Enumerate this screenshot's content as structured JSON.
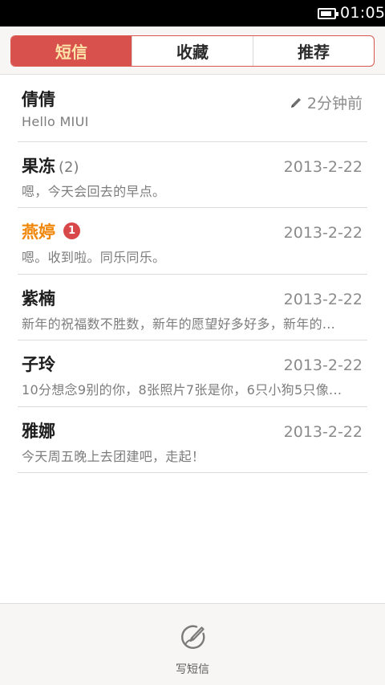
{
  "status_bar": {
    "time": "01:05",
    "battery_level": 0.85
  },
  "tabs": [
    {
      "label": "短信",
      "active": true
    },
    {
      "label": "收藏",
      "active": false
    },
    {
      "label": "推荐",
      "active": false
    }
  ],
  "conversations": [
    {
      "name": "倩倩",
      "count": "",
      "badge": "",
      "time": "2分钟前",
      "draft": true,
      "snippet": "Hello MIUI",
      "unread": false
    },
    {
      "name": "果冻",
      "count": "(2)",
      "badge": "",
      "time": "2013-2-22",
      "draft": false,
      "snippet": "嗯，今天会回去的早点。",
      "unread": false
    },
    {
      "name": "燕婷",
      "count": "",
      "badge": "1",
      "time": "2013-2-22",
      "draft": false,
      "snippet": "嗯。收到啦。同乐同乐。",
      "unread": true
    },
    {
      "name": "紫楠",
      "count": "",
      "badge": "",
      "time": "2013-2-22",
      "draft": false,
      "snippet": "新年的祝福数不胜数，新年的愿望好多好多，新年的...",
      "unread": false
    },
    {
      "name": "子玲",
      "count": "",
      "badge": "",
      "time": "2013-2-22",
      "draft": false,
      "snippet": "10分想念9别的你，8张照片7张是你，6只小狗5只像...",
      "unread": false
    },
    {
      "name": "雅娜",
      "count": "",
      "badge": "",
      "time": "2013-2-22",
      "draft": false,
      "snippet": "今天周五晚上去团建吧，走起！",
      "unread": false
    }
  ],
  "bottom_bar": {
    "compose_label": "写短信",
    "compose_icon": "compose-icon"
  },
  "colors": {
    "accent": "#d9514c",
    "tab_active_text": "#fbe3a7",
    "unread_name": "#f0870a",
    "badge": "#d8474a"
  }
}
